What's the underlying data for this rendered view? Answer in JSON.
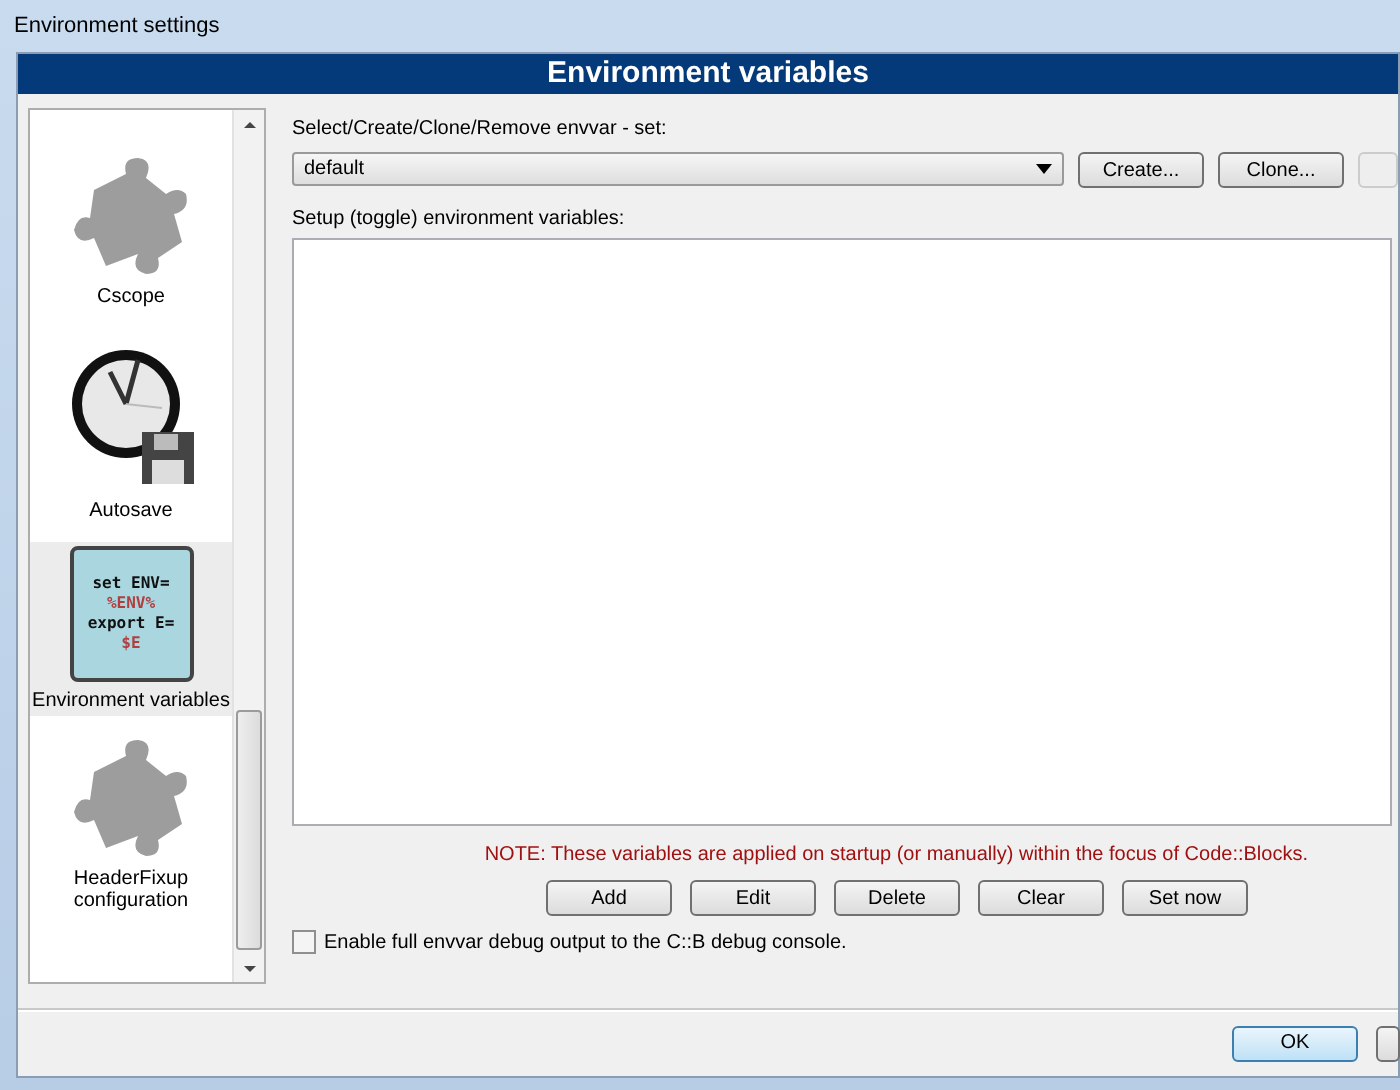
{
  "window": {
    "title": "Environment settings"
  },
  "header": "Environment variables",
  "sidebar": {
    "items": [
      {
        "label": "Cscope",
        "kind": "puzzle",
        "selected": false
      },
      {
        "label": "Autosave",
        "kind": "clock",
        "selected": false
      },
      {
        "label": "Environment variables",
        "kind": "script",
        "selected": true,
        "icon_text": [
          "set ENV=",
          "%ENV%",
          "export E=",
          "$E"
        ]
      },
      {
        "label": "HeaderFixup configuration",
        "kind": "puzzle",
        "selected": false
      }
    ]
  },
  "set_label": "Select/Create/Clone/Remove envvar - set:",
  "set_combo": {
    "value": "default"
  },
  "set_buttons": [
    "Create...",
    "Clone..."
  ],
  "list_label": "Setup (toggle) environment variables:",
  "note": "NOTE: These variables are applied on startup (or manually) within the focus of Code::Blocks.",
  "list_buttons": [
    "Add",
    "Edit",
    "Delete",
    "Clear",
    "Set now"
  ],
  "debug_option": {
    "label": "Enable full envvar debug output to the C::B debug console.",
    "checked": false
  },
  "dialog_buttons": [
    "OK"
  ]
}
